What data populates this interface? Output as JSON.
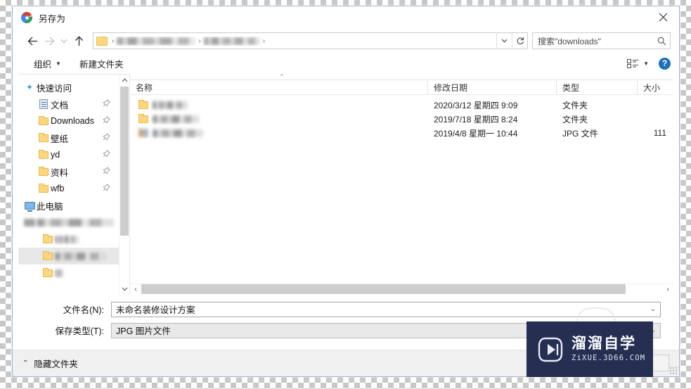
{
  "window": {
    "title": "另存为",
    "app_icon": "chrome-icon",
    "close_label": "✕"
  },
  "nav": {
    "back": "←",
    "forward": "→",
    "recent": "⌄",
    "up": "↑",
    "dropdown": "⌄",
    "refresh": "↻",
    "breadcrumb_separator": "›",
    "crumbs": [
      "",
      "",
      ""
    ]
  },
  "search": {
    "placeholder": "搜索\"downloads\"",
    "value": "搜索\"downloads\"",
    "icon": "magnifier-icon"
  },
  "toolbar": {
    "organize_label": "组织",
    "organize_caret": "▼",
    "new_folder_label": "新建文件夹",
    "view_caret": "▼",
    "help_label": "?"
  },
  "sidebar": {
    "scroll_up": "⌃",
    "scroll_down": "⌄",
    "items": [
      {
        "label": "快速访问",
        "icon": "star-icon",
        "indent": 0,
        "pinned": false,
        "blurred": false,
        "selected": false
      },
      {
        "label": "文档",
        "icon": "document-icon",
        "indent": 1,
        "pinned": true,
        "blurred": false,
        "selected": false
      },
      {
        "label": "Downloads",
        "icon": "folder-icon",
        "indent": 1,
        "pinned": true,
        "blurred": false,
        "selected": false
      },
      {
        "label": "壁纸",
        "icon": "folder-icon",
        "indent": 1,
        "pinned": true,
        "blurred": false,
        "selected": false
      },
      {
        "label": "yd",
        "icon": "folder-icon",
        "indent": 1,
        "pinned": true,
        "blurred": false,
        "selected": false
      },
      {
        "label": "资料",
        "icon": "folder-icon",
        "indent": 1,
        "pinned": true,
        "blurred": false,
        "selected": false
      },
      {
        "label": "wfb",
        "icon": "folder-icon",
        "indent": 1,
        "pinned": true,
        "blurred": false,
        "selected": false
      },
      {
        "label": "此电脑",
        "icon": "computer-icon",
        "indent": 0,
        "pinned": false,
        "blurred": false,
        "selected": false
      },
      {
        "label": "",
        "icon": "drive-icon",
        "indent": 0,
        "pinned": false,
        "blurred": true,
        "selected": false,
        "blur_width": 110
      },
      {
        "label": "",
        "icon": "folder-icon",
        "indent": 2,
        "pinned": false,
        "blurred": true,
        "selected": false,
        "blur_width": 34
      },
      {
        "label": "",
        "icon": "folder-icon",
        "indent": 2,
        "pinned": false,
        "blurred": true,
        "selected": true,
        "blur_width": 74
      },
      {
        "label": "",
        "icon": "folder-icon",
        "indent": 2,
        "pinned": false,
        "blurred": true,
        "selected": false,
        "blur_width": 12
      }
    ]
  },
  "filelist": {
    "sort_caret": "⌃",
    "columns": [
      "名称",
      "修改日期",
      "类型",
      "大小"
    ],
    "rows": [
      {
        "name": "",
        "name_blur_width": 50,
        "icon": "folder-icon",
        "date": "2020/3/12 星期四 9:09",
        "type": "文件夹",
        "size": ""
      },
      {
        "name": "",
        "name_blur_width": 66,
        "icon": "folder-icon",
        "date": "2019/7/18 星期四 8:24",
        "type": "文件夹",
        "size": ""
      },
      {
        "name": "",
        "name_blur_width": 72,
        "icon": "jpg-icon",
        "date": "2019/4/8 星期一 10:44",
        "type": "JPG 文件",
        "size": "111"
      }
    ],
    "hscroll_left": "‹",
    "hscroll_right": "›"
  },
  "form": {
    "filename_label": "文件名(N):",
    "filename_value": "未命名装修设计方案",
    "filetype_label": "保存类型(T):",
    "filetype_value": "JPG 图片文件",
    "combo_caret": "⌄"
  },
  "footer": {
    "hide_folders_label": "隐藏文件夹",
    "hide_folders_caret": "⌃",
    "save_label": "",
    "cancel_label": ""
  },
  "watermark": {
    "title": "溜溜自学",
    "url": "ZiXUE.3D66.COM"
  },
  "colors": {
    "accent": "#1a6fb5",
    "folder": "#fcd77f",
    "watermark_bg": "#242f52",
    "selection": "#e8e8e8"
  }
}
